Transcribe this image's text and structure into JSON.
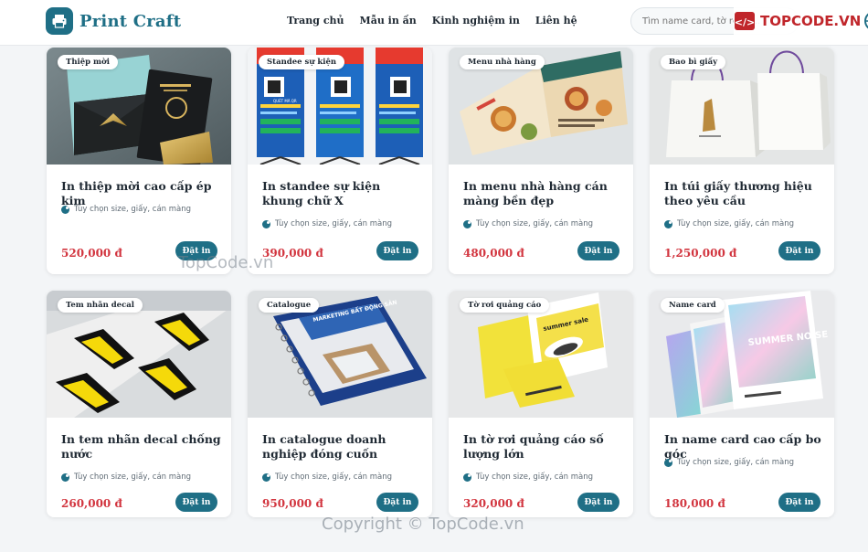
{
  "header": {
    "brand": "Print Craft",
    "nav": [
      {
        "label": "Trang chủ"
      },
      {
        "label": "Mẫu in ấn"
      },
      {
        "label": "Kinh nghiệm in"
      },
      {
        "label": "Liên hệ"
      }
    ],
    "search_placeholder": "Tìm name card, tờ rơi, c...",
    "partner_logo": "TOPCODE.VN"
  },
  "products": [
    {
      "tag": "Thiệp mời",
      "title": "In thiệp mời cao cấp ép kim",
      "options": "Tùy chọn size, giấy, cán màng",
      "price": "520,000 đ",
      "button": "Đặt in"
    },
    {
      "tag": "Standee sự kiện",
      "title": "In standee sự kiện khung chữ X",
      "options": "Tùy chọn size, giấy, cán màng",
      "price": "390,000 đ",
      "button": "Đặt in"
    },
    {
      "tag": "Menu nhà hàng",
      "title": "In menu nhà hàng cán màng bền đẹp",
      "options": "Tùy chọn size, giấy, cán màng",
      "price": "480,000 đ",
      "button": "Đặt in"
    },
    {
      "tag": "Bao bì giấy",
      "title": "In túi giấy thương hiệu theo yêu cầu",
      "options": "Tùy chọn size, giấy, cán màng",
      "price": "1,250,000 đ",
      "button": "Đặt in"
    },
    {
      "tag": "Tem nhãn decal",
      "title": "In tem nhãn decal chống nước",
      "options": "Tùy chọn size, giấy, cán màng",
      "price": "260,000 đ",
      "button": "Đặt in"
    },
    {
      "tag": "Catalogue",
      "title": "In catalogue doanh nghiệp đóng cuốn",
      "options": "Tùy chọn size, giấy, cán màng",
      "price": "950,000 đ",
      "button": "Đặt in"
    },
    {
      "tag": "Tờ rơi quảng cáo",
      "title": "In tờ rơi quảng cáo số lượng lớn",
      "options": "Tùy chọn size, giấy, cán màng",
      "price": "320,000 đ",
      "button": "Đặt in"
    },
    {
      "tag": "Name card",
      "title": "In name card cao cấp bo góc",
      "options": "Tùy chọn size, giấy, cán màng",
      "price": "180,000 đ",
      "button": "Đặt in"
    }
  ],
  "image_text": {
    "standee_qr_label": "QUÉT MÃ QR",
    "catalogue_cover": "MARKETING BẤT ĐỘNG SẢN",
    "flyer_headline": "summer sale",
    "namecard_headline": "SUMMER NOISE"
  },
  "watermarks": {
    "mid": "TopCode.vn",
    "footer": "Copyright © TopCode.vn"
  },
  "colors": {
    "accent": "#1f6f86",
    "price": "#d2353f",
    "brand_red": "#c0262b"
  }
}
